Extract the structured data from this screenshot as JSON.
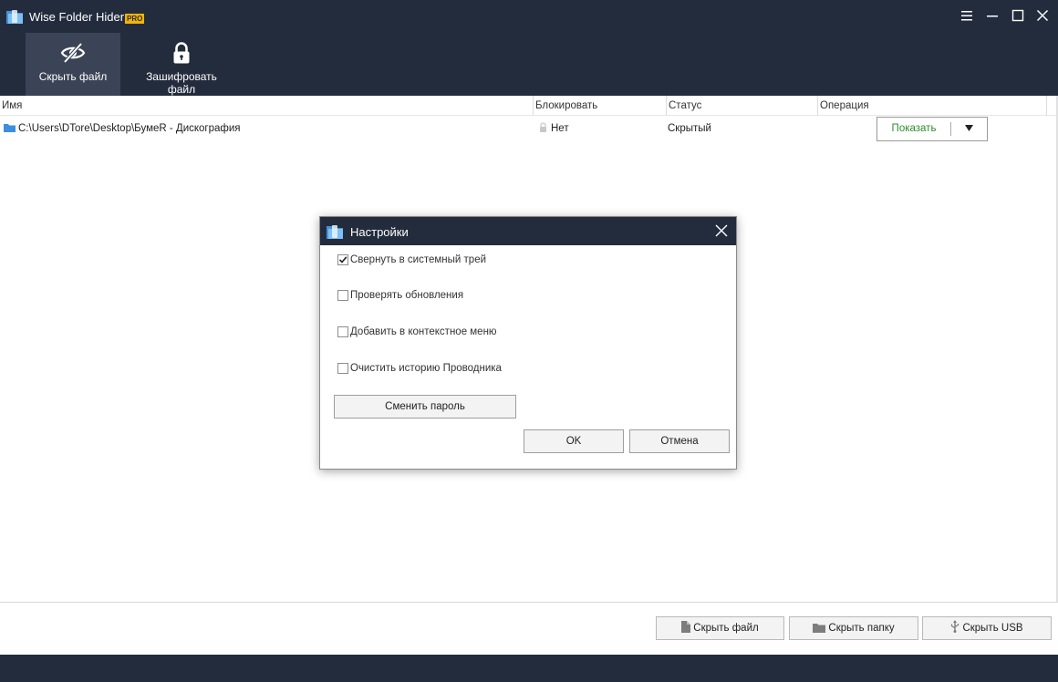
{
  "app": {
    "title": "Wise Folder Hider",
    "badge": "PRO",
    "accent_color": "#232c3d",
    "badge_color": "#f5b400"
  },
  "window_controls": {
    "menu_icon": "hamburger-icon",
    "minimize_icon": "minimize-icon",
    "maximize_icon": "maximize-icon",
    "close_icon": "close-icon"
  },
  "toolbar": {
    "hide_file_label": "Скрыть файл",
    "encrypt_file_label": "Зашифровать файл"
  },
  "table": {
    "columns": [
      "Имя",
      "Блокировать",
      "Статус",
      "Операция"
    ],
    "rows": [
      {
        "name": "C:\\Users\\DTore\\Desktop\\БумеR - Дискография",
        "lock": "Нет",
        "status": "Скрытый",
        "operation": "Показать"
      }
    ]
  },
  "bottom": {
    "hide_file": "Скрыть файл",
    "hide_folder": "Скрыть папку",
    "hide_usb": "Скрыть USB"
  },
  "dialog": {
    "title": "Настройки",
    "options": [
      {
        "label": "Свернуть в системный трей",
        "checked": true
      },
      {
        "label": "Проверять обновления",
        "checked": false
      },
      {
        "label": "Добавить в контекстное меню",
        "checked": false
      },
      {
        "label": "Очистить историю Проводника",
        "checked": false
      }
    ],
    "change_password": "Сменить пароль",
    "ok": "OK",
    "cancel": "Отмена"
  }
}
